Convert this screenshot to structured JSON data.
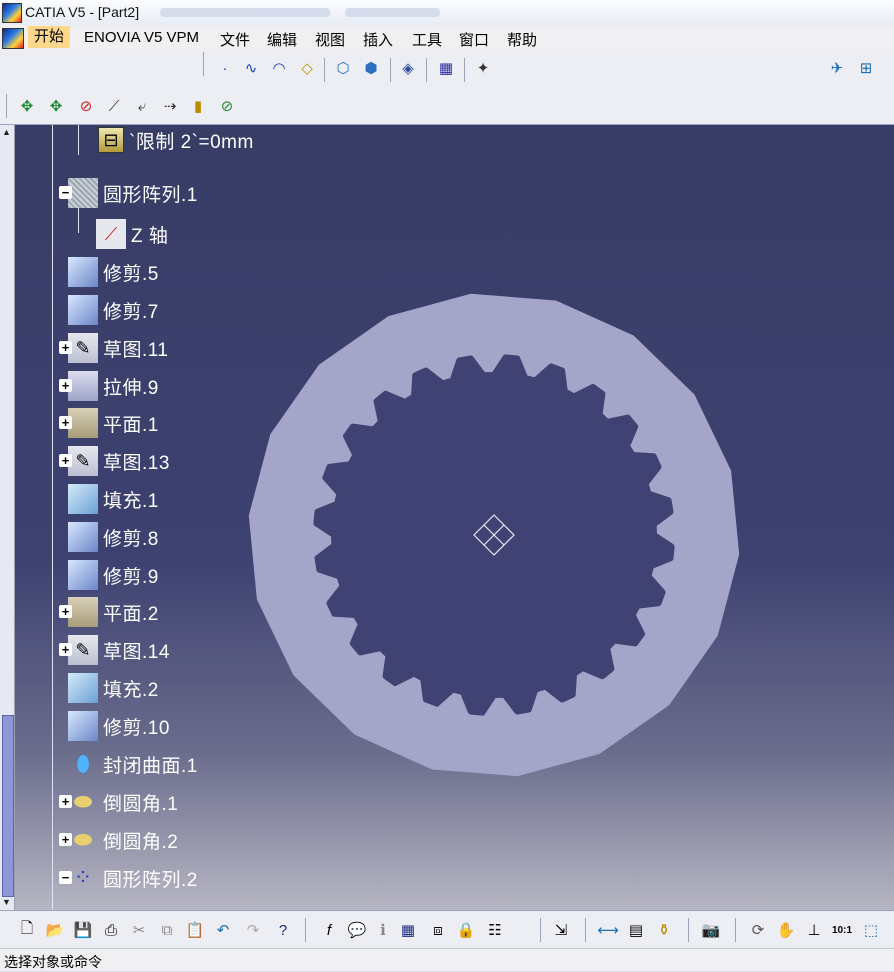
{
  "window": {
    "title": "CATIA V5 - [Part2]"
  },
  "menu": {
    "items": [
      "开始",
      "ENOVIA V5 VPM",
      "文件",
      "编辑",
      "视图",
      "插入",
      "工具",
      "窗口",
      "帮助"
    ]
  },
  "toolbar1": {
    "icons": [
      "point-icon",
      "spline-icon",
      "circle-icon",
      "line-icon",
      "extrude-icon",
      "revolve-icon",
      "plane-icon",
      "render-icon",
      "compass-icon",
      "zoom-icon",
      "fit-all-icon"
    ]
  },
  "toolbar2": {
    "icons": [
      "move-icon",
      "rotate-icon",
      "remove-icon",
      "tweak-icon",
      "snap-icon",
      "axis-icon",
      "align-icon",
      "measure-icon"
    ]
  },
  "tree": {
    "nodes": [
      {
        "label": "`限制 2`=0mm",
        "icon": "limit-icon",
        "expander": "",
        "dark": false
      },
      {
        "label": "圆形阵列.1",
        "icon": "pattern-icon",
        "expander": "−",
        "dark": false
      },
      {
        "label": "Z 轴",
        "icon": "axis-icon",
        "expander": "",
        "dark": false
      },
      {
        "label": "修剪.5",
        "icon": "trim-icon",
        "expander": "",
        "dark": true
      },
      {
        "label": "修剪.7",
        "icon": "trim-icon",
        "expander": "",
        "dark": true
      },
      {
        "label": "草图.11",
        "icon": "sketch-icon",
        "expander": "+",
        "dark": true
      },
      {
        "label": "拉伸.9",
        "icon": "extrude-icon",
        "expander": "+",
        "dark": true
      },
      {
        "label": "平面.1",
        "icon": "plane-icon",
        "expander": "+",
        "dark": true
      },
      {
        "label": "草图.13",
        "icon": "sketch-icon",
        "expander": "+",
        "dark": true
      },
      {
        "label": "填充.1",
        "icon": "fill-icon",
        "expander": "",
        "dark": true
      },
      {
        "label": "修剪.8",
        "icon": "trim-icon",
        "expander": "",
        "dark": true
      },
      {
        "label": "修剪.9",
        "icon": "trim-icon",
        "expander": "",
        "dark": true
      },
      {
        "label": "平面.2",
        "icon": "plane-icon",
        "expander": "+",
        "dark": true
      },
      {
        "label": "草图.14",
        "icon": "sketch-icon",
        "expander": "+",
        "dark": true
      },
      {
        "label": "填充.2",
        "icon": "fill-icon",
        "expander": "",
        "dark": true
      },
      {
        "label": "修剪.10",
        "icon": "trim-icon",
        "expander": "",
        "dark": true
      },
      {
        "label": "封闭曲面.1",
        "icon": "close-surface-icon",
        "expander": "",
        "dark": true
      },
      {
        "label": "倒圆角.1",
        "icon": "fillet-icon",
        "expander": "+",
        "dark": true
      },
      {
        "label": "倒圆角.2",
        "icon": "fillet-icon",
        "expander": "+",
        "dark": true
      },
      {
        "label": "圆形阵列.2",
        "icon": "pattern-icon",
        "expander": "−",
        "dark": true
      }
    ]
  },
  "geometry": {
    "outer_color": "#a4a5c8",
    "inner_color": "#3f4272",
    "teeth": 24
  },
  "bottom_toolbar": {
    "icons": [
      "new-icon",
      "open-icon",
      "save-icon",
      "print-icon",
      "cut-icon",
      "copy-icon",
      "paste-icon",
      "undo-icon",
      "redo-icon",
      "help-icon",
      "formula-icon",
      "comment-icon",
      "info-icon",
      "table-icon",
      "tree-icon",
      "lock-icon",
      "filter-icon",
      "export-icon",
      "measure-icon",
      "sheet-icon",
      "mass-icon",
      "camera-icon",
      "reset-icon",
      "pan-icon",
      "axis-icon",
      "scale-icon",
      "view-icon"
    ]
  },
  "status": {
    "text": "选择对象或命令"
  },
  "colors": {
    "accent": "#ffd78a",
    "tree_label_bg": "#2a2e54",
    "viewport_top": "#383d66"
  }
}
